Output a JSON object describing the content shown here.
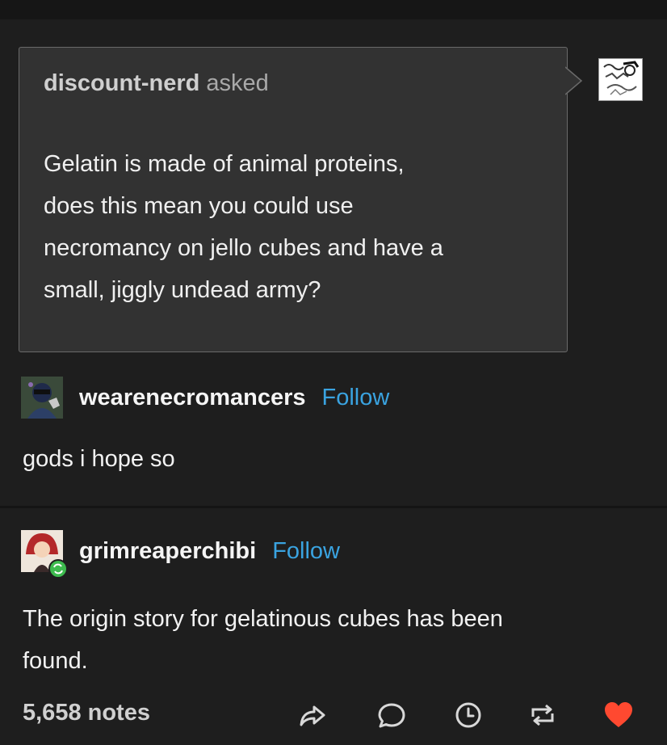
{
  "ask": {
    "asker": "discount-nerd",
    "verb": "asked",
    "lines": [
      "Gelatin is made of animal proteins,",
      "does this mean you could use",
      "necromancy on jello cubes and have a",
      "small, jiggly undead army?"
    ]
  },
  "posts": [
    {
      "username": "wearenecromancers",
      "follow_label": "Follow",
      "body": "gods i hope so"
    },
    {
      "username": "grimreaperchibi",
      "follow_label": "Follow",
      "body_lines": [
        "The origin story for gelatinous cubes has been",
        "found."
      ]
    }
  ],
  "footer": {
    "notes": "5,658 notes",
    "icons": [
      "share-icon",
      "reply-icon",
      "queue-icon",
      "reblog-icon",
      "like-icon"
    ]
  },
  "colors": {
    "background": "#1e1e1e",
    "ask_box": "#323232",
    "follow": "#3aa3e0",
    "like": "#ff4930",
    "reblog_badge": "#3dbb4e"
  }
}
